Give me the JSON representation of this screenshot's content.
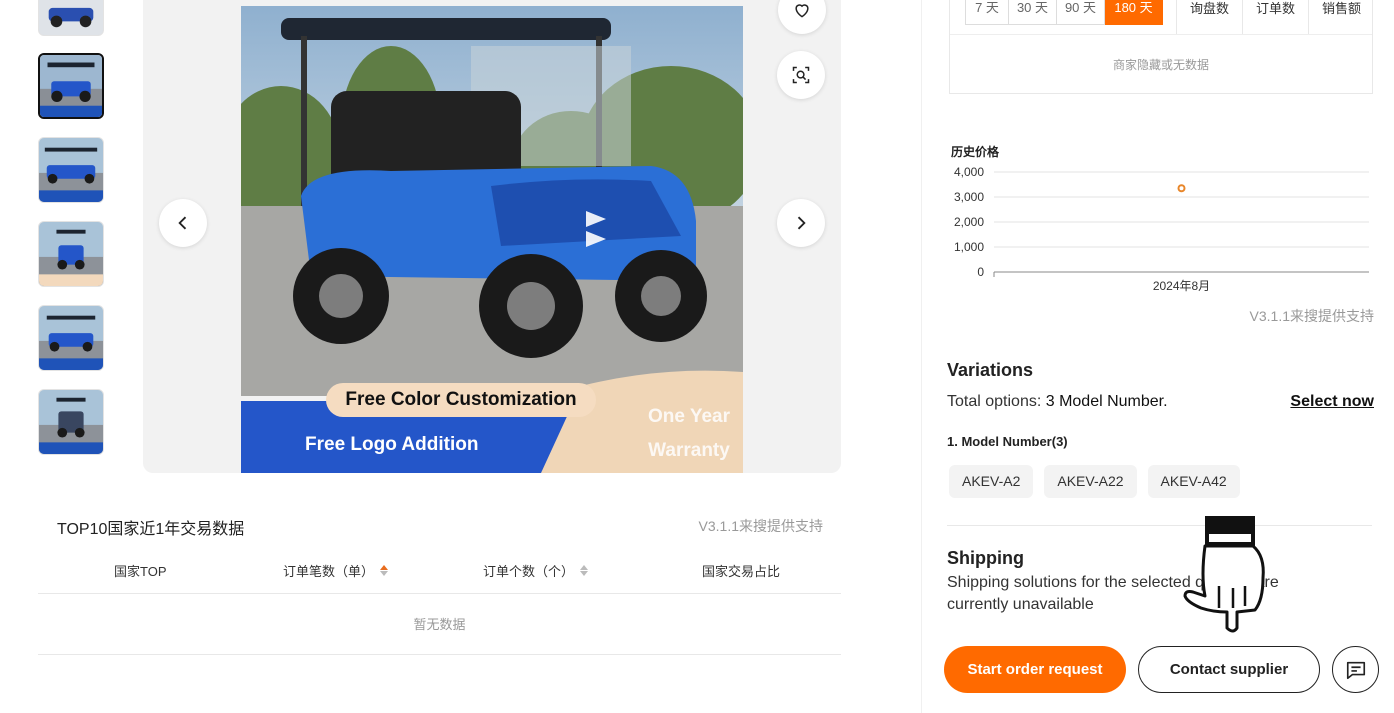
{
  "gallery": {
    "thumbnails": [
      {
        "name": "thumb-1",
        "active": false
      },
      {
        "name": "thumb-2",
        "active": true
      },
      {
        "name": "thumb-3",
        "active": false
      },
      {
        "name": "thumb-4",
        "active": false
      },
      {
        "name": "thumb-5",
        "active": false
      },
      {
        "name": "thumb-6",
        "active": false
      }
    ],
    "banner": {
      "line1": "Free Color Customization",
      "line2": "Free Logo Addition",
      "line3": "One Year Warranty"
    },
    "icons": {
      "favorite": "heart-icon",
      "search": "image-search-icon",
      "prev": "chevron-left-icon",
      "next": "chevron-right-icon"
    }
  },
  "trade": {
    "title": "TOP10国家近1年交易数据",
    "credit": "V3.1.1来搜提供支持",
    "columns": [
      "国家TOP",
      "订单笔数（单）",
      "订单个数（个）",
      "国家交易占比"
    ],
    "empty": "暂无数据"
  },
  "stats": {
    "ranges": [
      "7 天",
      "30 天",
      "90 天",
      "180 天"
    ],
    "active_range": "180 天",
    "columns": [
      "询盘数",
      "订单数",
      "销售额"
    ],
    "empty": "商家隐藏或无数据"
  },
  "price_history": {
    "title": "历史价格",
    "credit": "V3.1.1来搜提供支持",
    "chart_data": {
      "type": "scatter",
      "x": [
        "2024年8月"
      ],
      "y": [
        3350
      ],
      "ylim": [
        0,
        4000
      ],
      "yticks": [
        "0",
        "1,000",
        "2,000",
        "3,000",
        "4,000"
      ],
      "xticks": [
        "2024年8月"
      ],
      "title": "历史价格",
      "grid": true,
      "color": "#e8862a"
    }
  },
  "variations": {
    "title": "Variations",
    "total_prefix": "Total options:",
    "total_value": "3 Model Number.",
    "select_now": "Select now",
    "model_title": "1. Model Number(3)",
    "models": [
      "AKEV-A2",
      "AKEV-A22",
      "AKEV-A42"
    ]
  },
  "shipping": {
    "title": "Shipping",
    "desc": "Shipping solutions for the selected quantity are currently unavailable"
  },
  "actions": {
    "order": "Start order request",
    "contact": "Contact supplier",
    "chat_icon": "chat-icon"
  },
  "colors": {
    "accent": "#ff6a00",
    "chart_point": "#e8862a"
  }
}
